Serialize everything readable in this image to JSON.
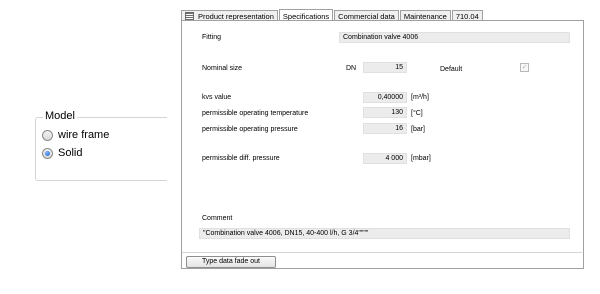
{
  "model": {
    "legend": "Model",
    "options": [
      {
        "label": "wire frame",
        "selected": false
      },
      {
        "label": "Solid",
        "selected": true
      }
    ]
  },
  "tabs": [
    {
      "label": "Product representation",
      "icon": "list-icon",
      "active": false
    },
    {
      "label": "Specifications",
      "active": true
    },
    {
      "label": "Commercial data",
      "active": false
    },
    {
      "label": "Maintenance",
      "active": false
    },
    {
      "label": "710.04",
      "active": false
    }
  ],
  "specs": {
    "fitting_label": "Fitting",
    "fitting_value": "Combination valve 4006",
    "nominal_size_label": "Nominal size",
    "dn_label": "DN",
    "dn_value": "15",
    "default_label": "Default",
    "default_checked": true,
    "kvs_label": "kvs value",
    "kvs_value": "0,40000",
    "kvs_unit": "[m³/h]",
    "temp_label": "permissible operating temperature",
    "temp_value": "130",
    "temp_unit": "[°C]",
    "pressure_label": "permissible operating pressure",
    "pressure_value": "16",
    "pressure_unit": "[bar]",
    "diff_label": "permissible diff. pressure",
    "diff_value": "4 000",
    "diff_unit": "[mbar]",
    "comment_label": "Comment",
    "comment_value": "\"Combination valve 4006, DN15, 40-400 l/h, G 3/4\"\"\"\""
  },
  "footer": {
    "fade_button": "Type data fade out"
  }
}
